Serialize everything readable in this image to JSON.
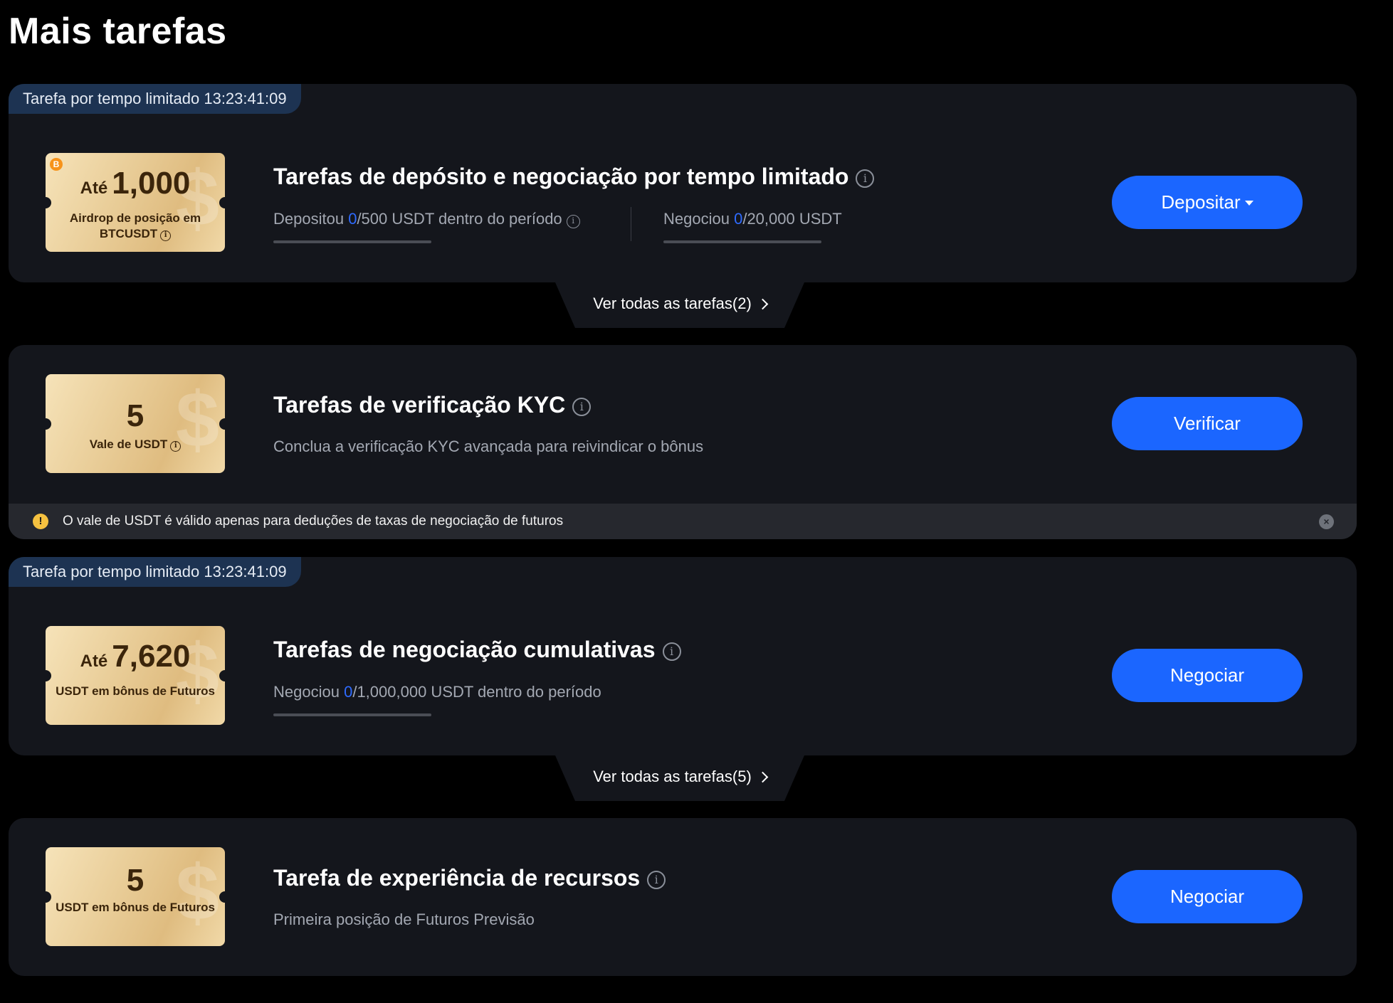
{
  "page": {
    "title": "Mais tarefas"
  },
  "tasks": [
    {
      "timer_label": "Tarefa por tempo limitado 13:23:41:09",
      "ticket": {
        "prefix": "Até",
        "amount": "1,000",
        "label": "Airdrop de posição em BTCUSDT",
        "coin": "B"
      },
      "title": "Tarefas de depósito e negociação por tempo limitado",
      "progress_a": {
        "prefix": "Depositou ",
        "current": "0",
        "suffix": "/500 USDT dentro do período"
      },
      "progress_b": {
        "prefix": "Negociou ",
        "current": "0",
        "suffix": "/20,000 USDT"
      },
      "button": "Depositar"
    },
    {
      "ticket": {
        "amount": "5",
        "label": "Vale de USDT"
      },
      "title": "Tarefas de verificação KYC",
      "subtitle": "Conclua a verificação KYC avançada para reivindicar o bônus",
      "button": "Verificar",
      "notice": "O vale de USDT é válido apenas para deduções de taxas de negociação de futuros"
    },
    {
      "timer_label": "Tarefa por tempo limitado 13:23:41:09",
      "ticket": {
        "prefix": "Até",
        "amount": "7,620",
        "label": "USDT em bônus de Futuros"
      },
      "title": "Tarefas de negociação cumulativas",
      "progress_a": {
        "prefix": "Negociou ",
        "current": "0",
        "suffix": "/1,000,000 USDT dentro do período"
      },
      "button": "Negociar"
    },
    {
      "ticket": {
        "amount": "5",
        "label": "USDT em bônus de Futuros"
      },
      "title": "Tarefa de experiência de recursos",
      "subtitle": "Primeira posição de Futuros Previsão",
      "button": "Negociar"
    }
  ],
  "see_all": [
    "Ver todas as tarefas(2)",
    "Ver todas as tarefas(5)"
  ],
  "icons": {
    "info": "info-icon",
    "warning": "warning-icon",
    "close": "close-icon",
    "chevron": "chevron-right-icon",
    "caret": "caret-down-icon"
  },
  "colors": {
    "accent": "#1b66ff",
    "highlight": "#2f6bff",
    "card": "#14161c",
    "timer_tag": "#1d3352",
    "warning": "#f5c140"
  }
}
